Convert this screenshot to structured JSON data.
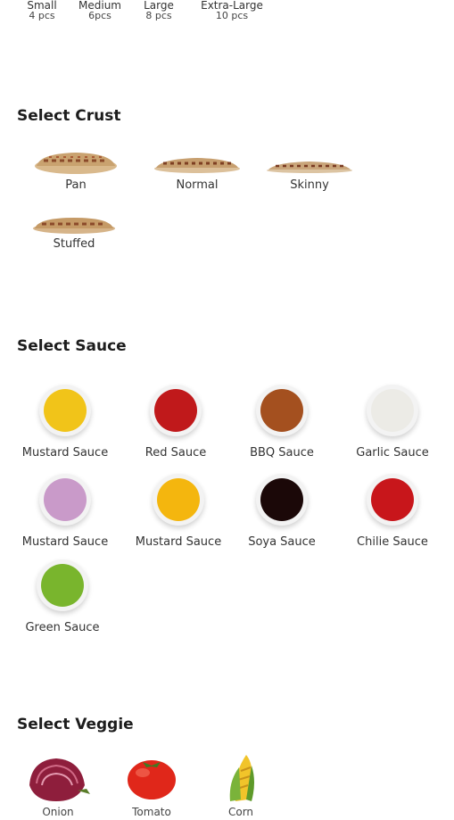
{
  "sizes": [
    {
      "label": "Small",
      "pieces": "4 pcs"
    },
    {
      "label": "Medium",
      "pieces": "6pcs"
    },
    {
      "label": "Large",
      "pieces": "8 pcs"
    },
    {
      "label": "Extra-Large",
      "pieces": "10 pcs"
    }
  ],
  "crust": {
    "title": "Select Crust",
    "items": [
      {
        "label": "Pan"
      },
      {
        "label": "Normal"
      },
      {
        "label": "Skinny"
      },
      {
        "label": "Stuffed"
      }
    ]
  },
  "sauce": {
    "title": "Select Sauce",
    "items": [
      {
        "label": "Mustard Sauce",
        "color": "#f1c419"
      },
      {
        "label": "Red Sauce",
        "color": "#c0191b"
      },
      {
        "label": "BBQ Sauce",
        "color": "#a4501f"
      },
      {
        "label": "Garlic Sauce",
        "color": "#ecebe6"
      },
      {
        "label": "Mustard Sauce",
        "color": "#c99ac9"
      },
      {
        "label": "Mustard Sauce",
        "color": "#f4b60e"
      },
      {
        "label": "Soya Sauce",
        "color": "#1b0808"
      },
      {
        "label": "Chilie Sauce",
        "color": "#c8161b"
      },
      {
        "label": "Green Sauce",
        "color": "#79b52d"
      }
    ]
  },
  "veggie": {
    "title": "Select Veggie",
    "items": [
      {
        "label": "Onion"
      },
      {
        "label": "Tomato"
      },
      {
        "label": "Corn"
      }
    ]
  }
}
